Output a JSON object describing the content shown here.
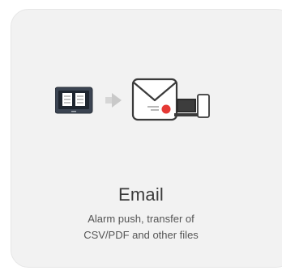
{
  "card": {
    "title": "Email",
    "description_lines": [
      "Alarm push, transfer of",
      "CSV/PDF and other files"
    ],
    "icons": [
      "hmi-panel-icon",
      "arrow-right-icon",
      "envelope-icon",
      "alert-badge-icon",
      "laptop-icon",
      "phone-icon"
    ]
  }
}
